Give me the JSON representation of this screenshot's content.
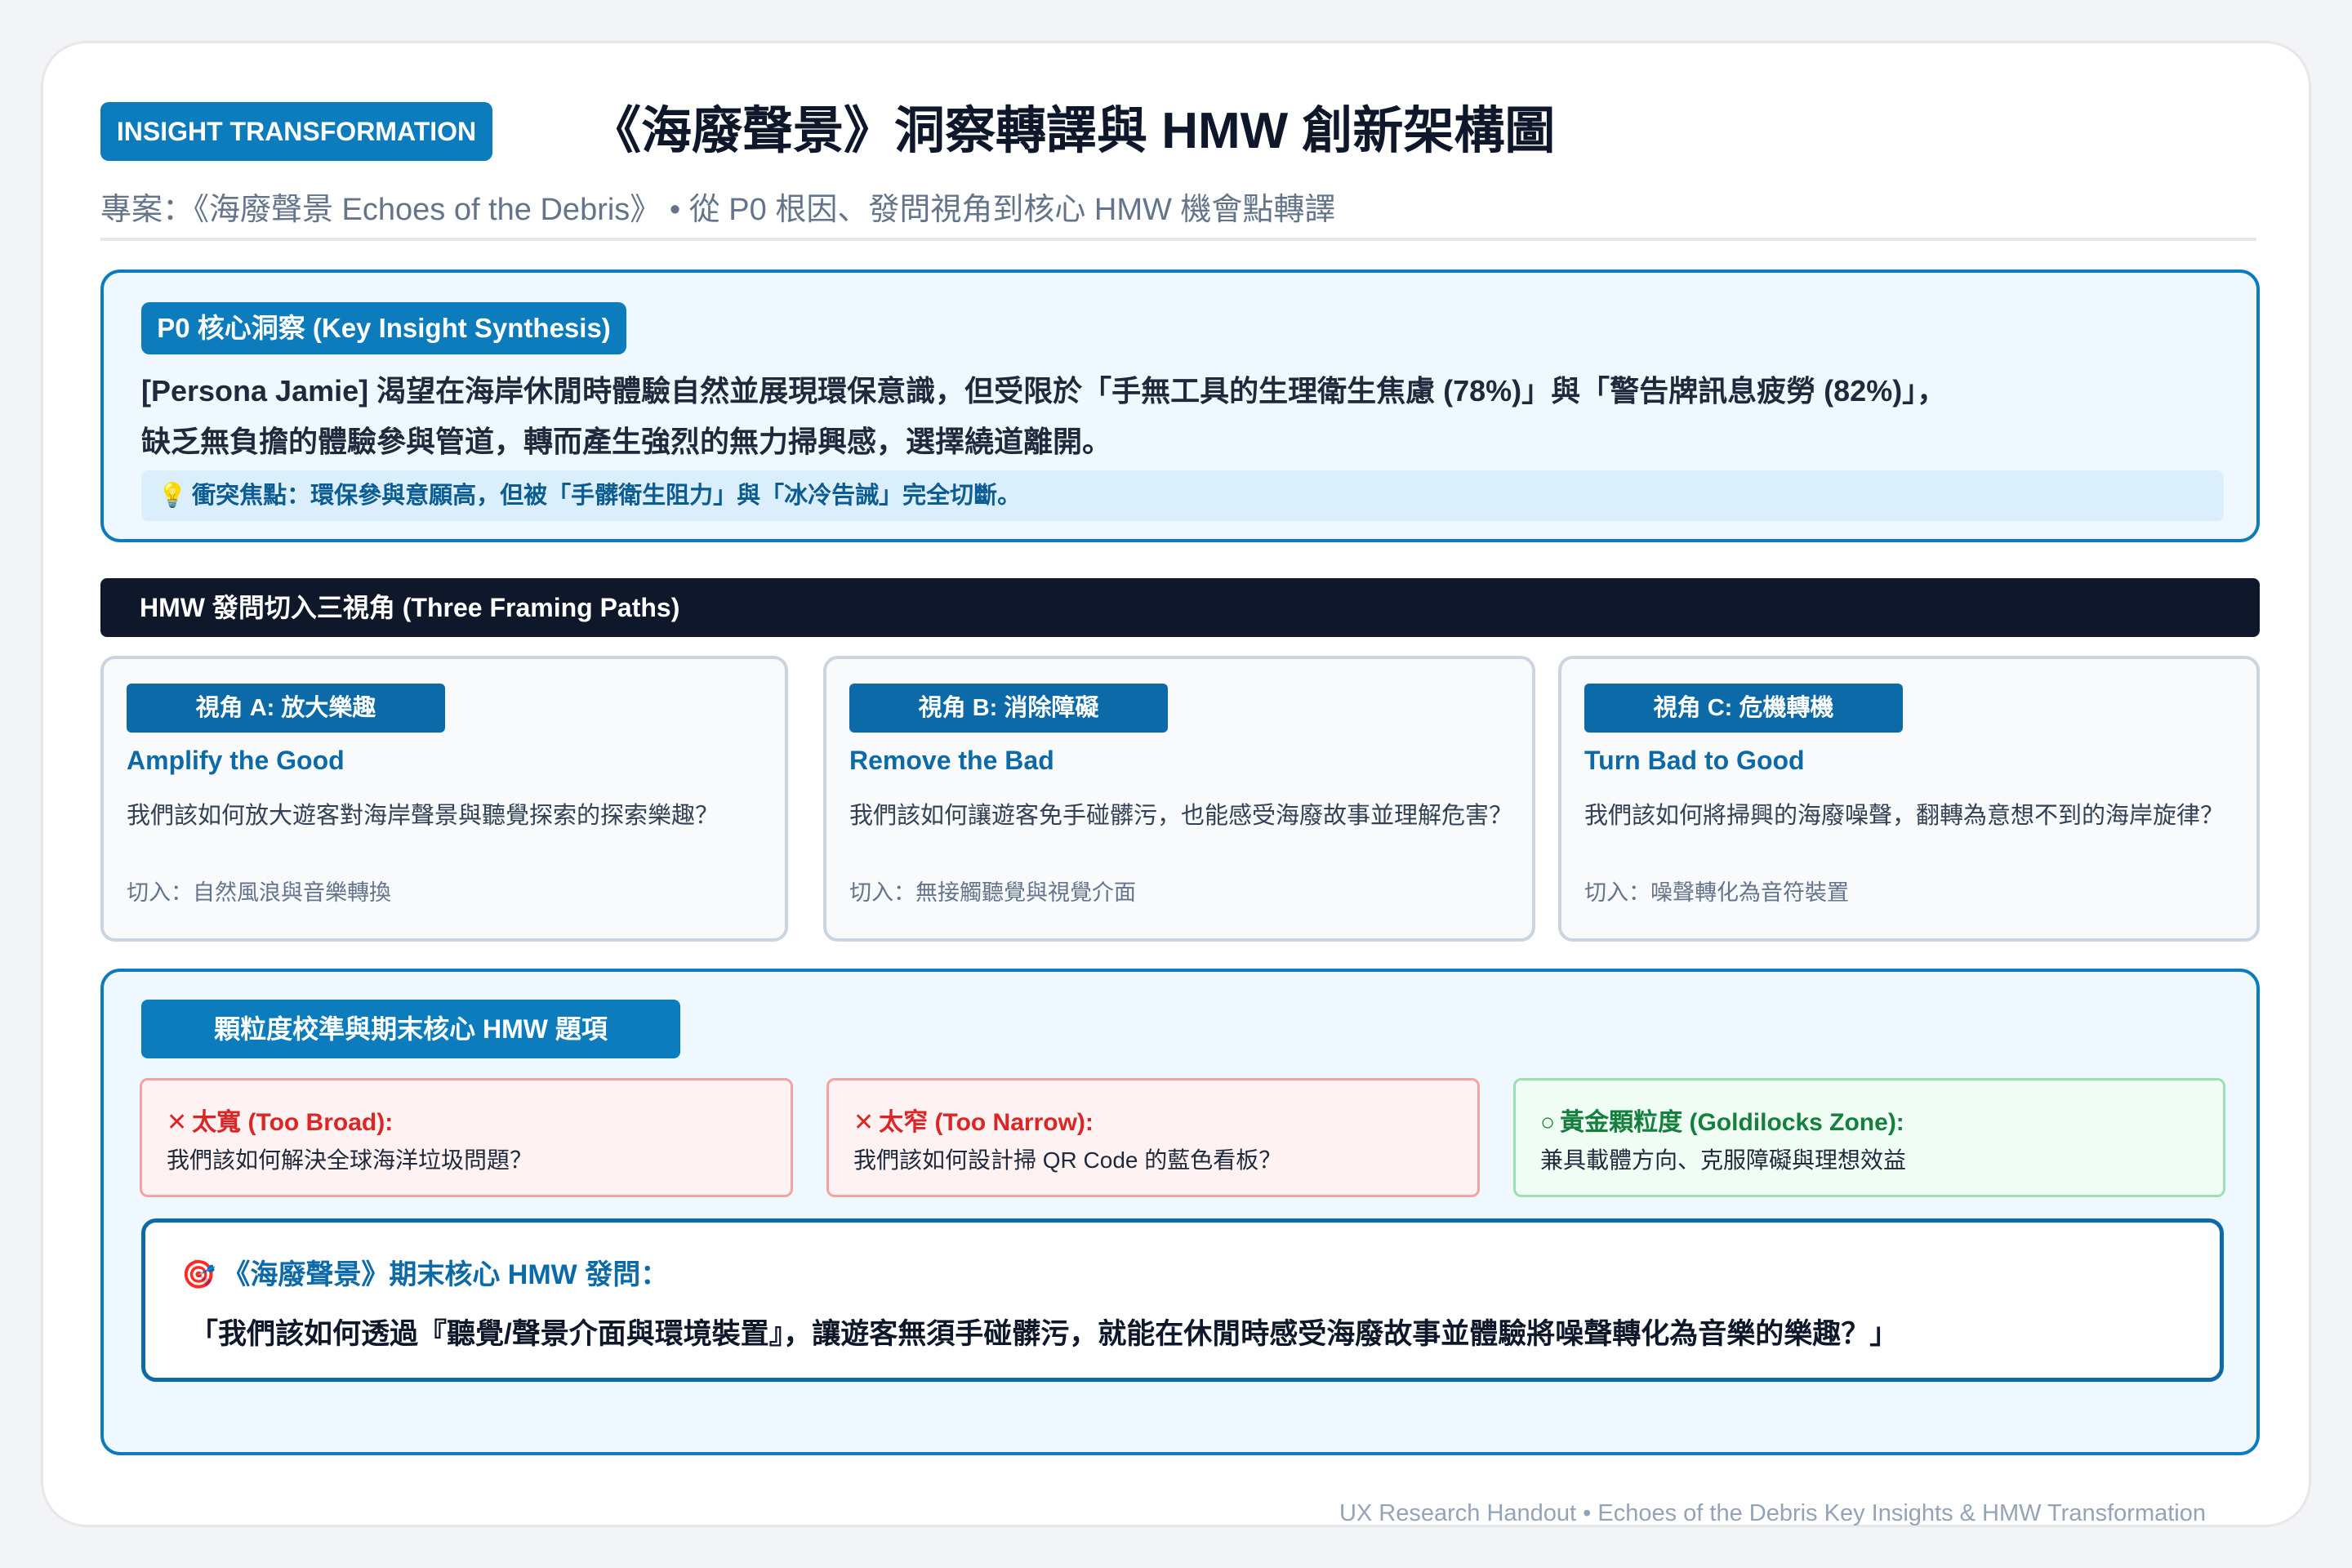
{
  "header": {
    "badge": "INSIGHT TRANSFORMATION",
    "title": "《海廢聲景》洞察轉譯與 HMW 創新架構圖",
    "subtitle": "專案：《海廢聲景 Echoes of the Debris》 • 從 P0 根因、發問視角到核心 HMW 機會點轉譯"
  },
  "p0": {
    "badge": "P0 核心洞察 (Key Insight Synthesis)",
    "line1": "[Persona Jamie] 渴望在海岸休閒時體驗自然並展現環保意識，但受限於「手無工具的生理衛生焦慮 (78%)」與「警告牌訊息疲勞 (82%)」，",
    "line2": "缺乏無負擔的體驗參與管道，轉而產生強烈的無力掃興感，選擇繞道離開。",
    "note": "衝突焦點：環保參與意願高，但被「手髒衛生阻力」與「冰冷告誡」完全切斷。",
    "note_icon": "lightbulb-icon"
  },
  "framing": {
    "section_title": "HMW 發問切入三視角 (Three Framing Paths)",
    "paths": [
      {
        "badge": "視角 A: 放大樂趣",
        "en": "Amplify the Good",
        "question": "我們該如何放大遊客對海岸聲景與聽覺探索的探索樂趣？",
        "cut": "切入：自然風浪與音樂轉換"
      },
      {
        "badge": "視角 B: 消除障礙",
        "en": "Remove the Bad",
        "question": "我們該如何讓遊客免手碰髒污，也能感受海廢故事並理解危害？",
        "cut": "切入：無接觸聽覺與視覺介面"
      },
      {
        "badge": "視角 C: 危機轉機",
        "en": "Turn Bad to Good",
        "question": "我們該如何將掃興的海廢噪聲，翻轉為意想不到的海岸旋律？",
        "cut": "切入：噪聲轉化為音符裝置"
      }
    ]
  },
  "granularity": {
    "section_title": "顆粒度校準與期末核心 HMW 題項",
    "broad": {
      "mark": "✕",
      "label": "太寬 (Too Broad):",
      "text": "我們該如何解決全球海洋垃圾問題？"
    },
    "narrow": {
      "mark": "✕",
      "label": "太窄 (Too Narrow):",
      "text": "我們該如何設計掃 QR Code 的藍色看板？"
    },
    "golden": {
      "mark": "○",
      "label": "黃金顆粒度 (Goldilocks Zone):",
      "text": "兼具載體方向、克服障礙與理想效益"
    },
    "final_title": "《海廢聲景》期末核心 HMW 發問：",
    "final_question": "「我們該如何透過『聽覺/聲景介面與環境裝置』，讓遊客無須手碰髒污，就能在休閒時感受海廢故事並體驗將噪聲轉化為音樂的樂趣？」"
  },
  "footer": "UX Research Handout • Echoes of the Debris Key Insights & HMW Transformation"
}
